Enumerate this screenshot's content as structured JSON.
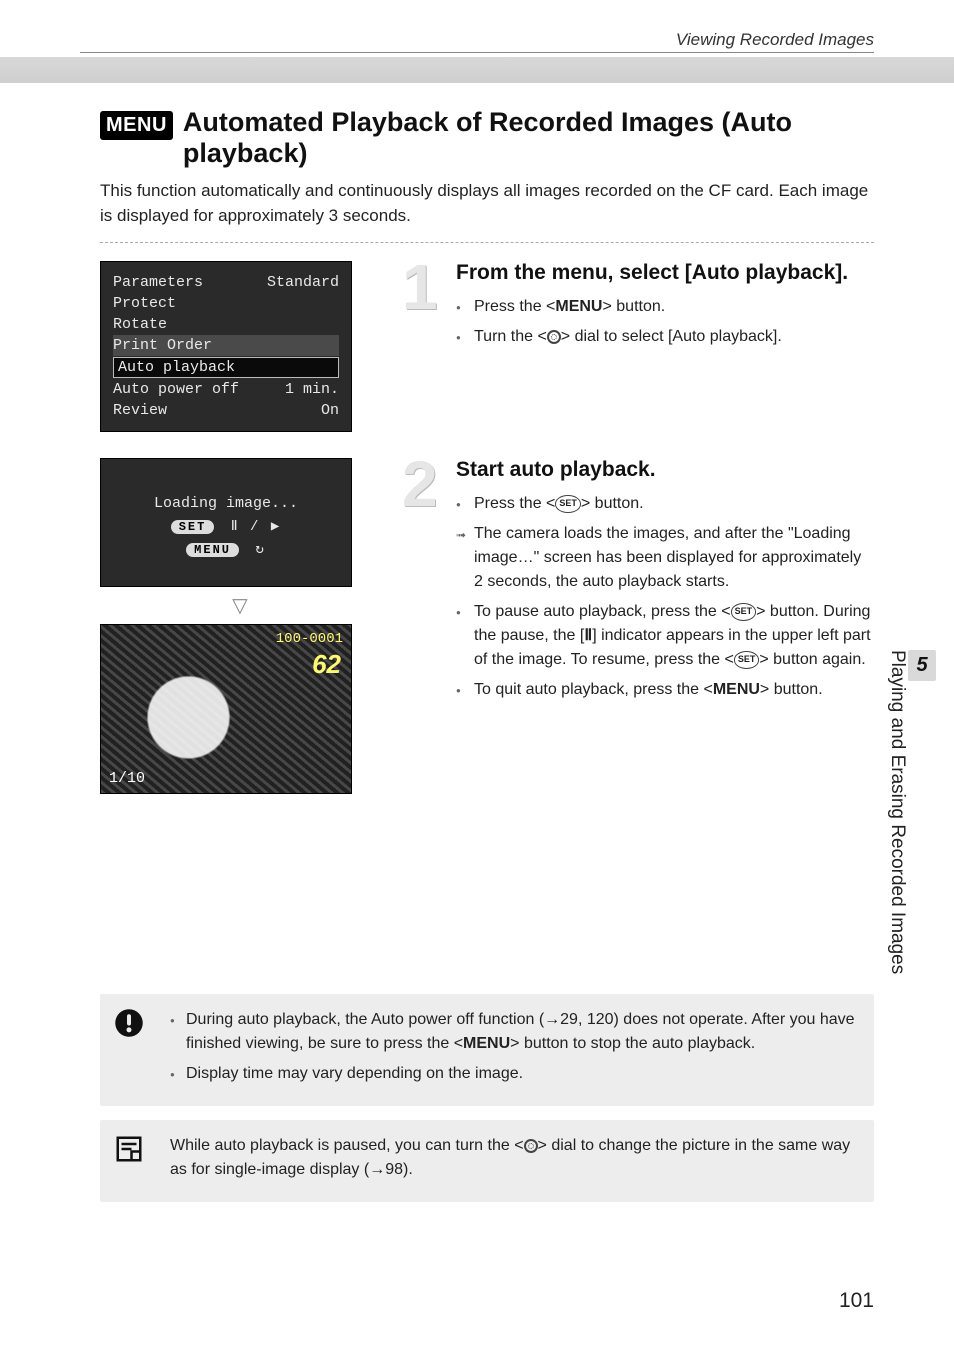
{
  "header": {
    "breadcrumb": "Viewing Recorded Images"
  },
  "title": {
    "badge": "MENU",
    "text": "Automated Playback of Recorded Images (Auto playback)"
  },
  "intro": "This function automatically and continuously displays all images recorded on the CF card. Each image is displayed for approximately 3 seconds.",
  "lcd_menu": {
    "rows": [
      {
        "label": "Parameters",
        "value": "Standard"
      },
      {
        "label": "Protect",
        "value": ""
      },
      {
        "label": "Rotate",
        "value": ""
      },
      {
        "label": "Print Order",
        "value": ""
      },
      {
        "label": "Auto playback",
        "value": "",
        "selected": true
      },
      {
        "label": "Auto power off",
        "value": "1 min."
      },
      {
        "label": "Review",
        "value": "On"
      }
    ]
  },
  "loading": {
    "text": "Loading image...",
    "set_label": "SET",
    "menu_label": "MENU",
    "controls": "Ⅱ  /  ▶",
    "return_glyph": "↻"
  },
  "photo": {
    "folder": "100-0001",
    "counter": "62",
    "index": "1/10"
  },
  "step1": {
    "num": "1",
    "heading": "From the menu, select [Auto playback].",
    "b1_a": "Press the <",
    "b1_b": "MENU",
    "b1_c": "> button.",
    "b2_a": "Turn the <",
    "b2_b": "> dial to select [Auto playback]."
  },
  "step2": {
    "num": "2",
    "heading": "Start auto playback.",
    "b1_a": "Press the <",
    "b1_b": "> button.",
    "b2": "The camera loads the images, and after the \"Loading image…\" screen has been displayed for approximately 2 seconds, the auto playback starts.",
    "b3_a": "To pause auto playback, press the <",
    "b3_b": "> button. During the pause, the [",
    "b3_c": "] indicator appears in the upper left part of the image. To resume, press the <",
    "b3_d": "> button again.",
    "pause_glyph": "Ⅱ",
    "b4_a": "To quit auto playback, press the <",
    "b4_b": "MENU",
    "b4_c": "> button."
  },
  "sidetab": {
    "chapter": "5",
    "label": "Playing and Erasing Recorded Images"
  },
  "warn": {
    "l1_a": "During auto playback, the Auto power off function (→29, 120) does not operate. After you have finished viewing, be sure to press the <",
    "l1_b": "MENU",
    "l1_c": "> button to stop the auto playback.",
    "l2": "Display time may vary depending on the image."
  },
  "tip": {
    "t_a": "While auto playback is paused, you can turn the <",
    "t_b": "> dial to change the picture in the same way as for single-image display (→98)."
  },
  "page": "101"
}
